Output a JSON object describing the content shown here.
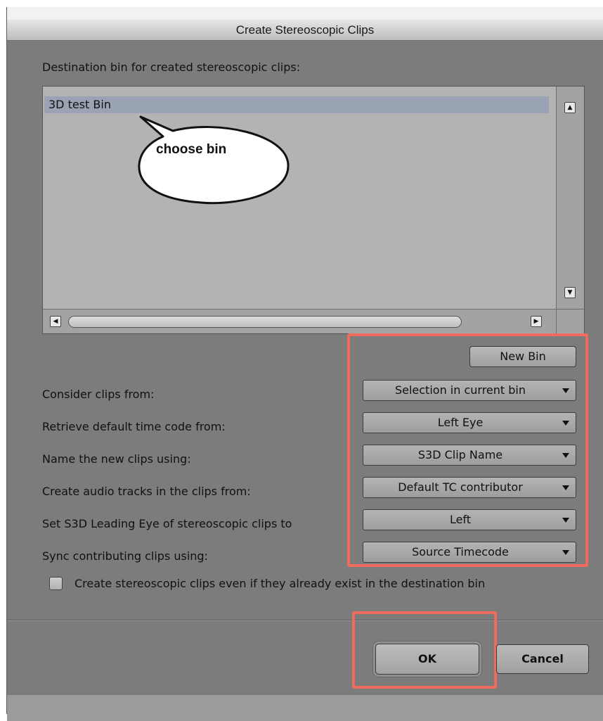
{
  "dialog": {
    "title": "Create Stereoscopic Clips",
    "destination_label": "Destination bin for created stereoscopic clips:",
    "bins": [
      {
        "name": "3D test Bin",
        "selected": true
      }
    ],
    "callout_text": "choose bin",
    "new_bin_label": "New Bin",
    "options": [
      {
        "label": "Consider clips from:",
        "value": "Selection in current bin"
      },
      {
        "label": "Retrieve default time code from:",
        "value": "Left Eye"
      },
      {
        "label": "Name the new clips using:",
        "value": "S3D Clip Name"
      },
      {
        "label": "Create audio tracks in the clips from:",
        "value": "Default TC contributor"
      },
      {
        "label": "Set S3D Leading Eye of stereoscopic clips to",
        "value": "Left"
      },
      {
        "label": "Sync contributing clips using:",
        "value": "Source Timecode"
      }
    ],
    "checkbox": {
      "label": "Create stereoscopic clips even if they already exist in the destination bin",
      "checked": false
    },
    "ok_label": "OK",
    "cancel_label": "Cancel"
  },
  "colors": {
    "dialog_bg": "#7c7c7c",
    "highlight_box": "#f06a5e",
    "selected_row": "#9aa3b3"
  }
}
